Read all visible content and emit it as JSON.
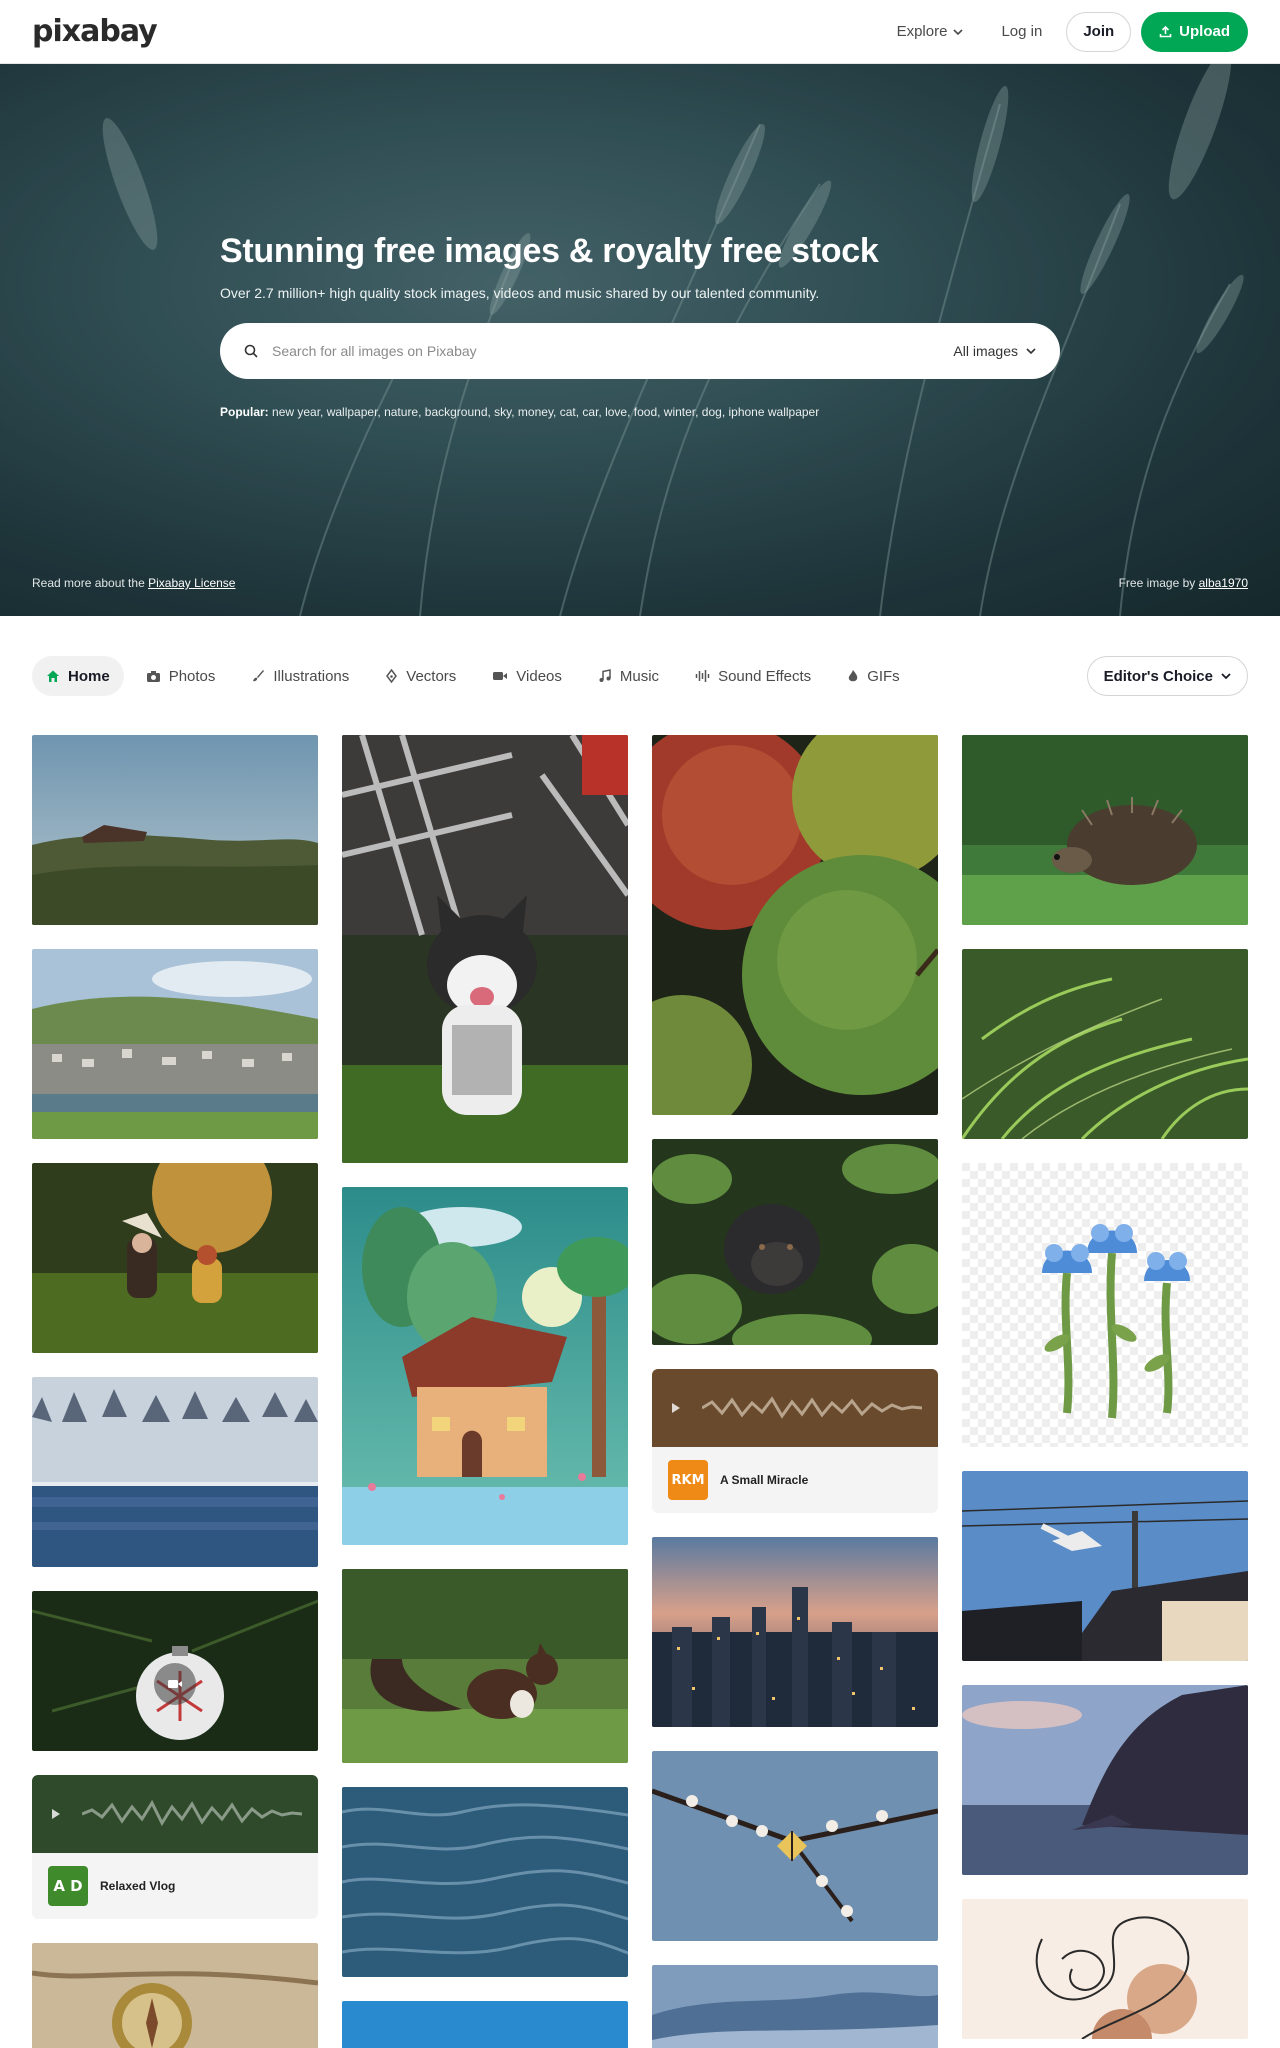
{
  "header": {
    "logo": "pixabay",
    "explore": "Explore",
    "login": "Log in",
    "join": "Join",
    "upload": "Upload"
  },
  "hero": {
    "title": "Stunning free images & royalty free stock",
    "subtitle": "Over 2.7 million+ high quality stock images, videos and music shared by our talented community.",
    "search_placeholder": "Search for all images on Pixabay",
    "search_type": "All images",
    "popular_label": "Popular:",
    "popular_terms": "new year, wallpaper, nature, background, sky, money, cat, car, love, food, winter, dog, iphone wallpaper",
    "license_text": "Read more about the",
    "license_link": "Pixabay License",
    "credit_text": "Free image by",
    "credit_link": "alba1970"
  },
  "tabs": [
    "Home",
    "Photos",
    "Illustrations",
    "Vectors",
    "Videos",
    "Music",
    "Sound Effects",
    "GIFs"
  ],
  "tab_icons": [
    "home-icon",
    "camera-icon",
    "brush-icon",
    "pen-nib-icon",
    "video-camera-icon",
    "music-note-icon",
    "soundwave-icon",
    "gif-icon"
  ],
  "filter": "Editor's Choice",
  "audio_tracks": [
    {
      "title": "A Small Miracle",
      "initials": "RKM",
      "color": "#f08a16",
      "bg": "#6a4a2c"
    },
    {
      "title": "Relaxed Vlog",
      "initials": "A D",
      "color": "#3f8a2a",
      "bg": "#2f4a2a"
    }
  ],
  "colors": {
    "brand": "#02a756",
    "text": "#191b26"
  }
}
